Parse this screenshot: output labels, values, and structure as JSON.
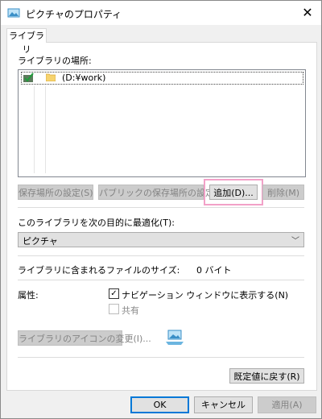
{
  "window": {
    "title": "ピクチャのプロパティ",
    "close_glyph": "✕"
  },
  "tabs": [
    {
      "label": "ライブラリ"
    }
  ],
  "library": {
    "locations_label": "ライブラリの場所:",
    "locations": [
      {
        "name": "(D:¥work)"
      }
    ],
    "buttons": {
      "set_save_location": "保存場所の設定(S)",
      "set_public_save_location": "パブリックの保存場所の設定(P)",
      "add": "追加(D)...",
      "remove": "削除(M)"
    },
    "optimize_label": "このライブラリを次の目的に最適化(T):",
    "optimize_value": "ピクチャ",
    "size_label": "ライブラリに含まれるファイルのサイズ:",
    "size_value": "0 バイト",
    "attributes_label": "属性:",
    "show_in_nav_label": "ナビゲーション ウィンドウに表示する(N)",
    "show_in_nav_checked": true,
    "shared_label": "共有",
    "shared_checked": false,
    "change_icon_button": "ライブラリのアイコンの変更(I)...",
    "restore_defaults_button": "既定値に戻す(R)"
  },
  "footer": {
    "ok": "OK",
    "cancel": "キャンセル",
    "apply": "適用(A)"
  },
  "colors": {
    "accent": "#0078d7",
    "highlight": "#f2a1c8"
  }
}
